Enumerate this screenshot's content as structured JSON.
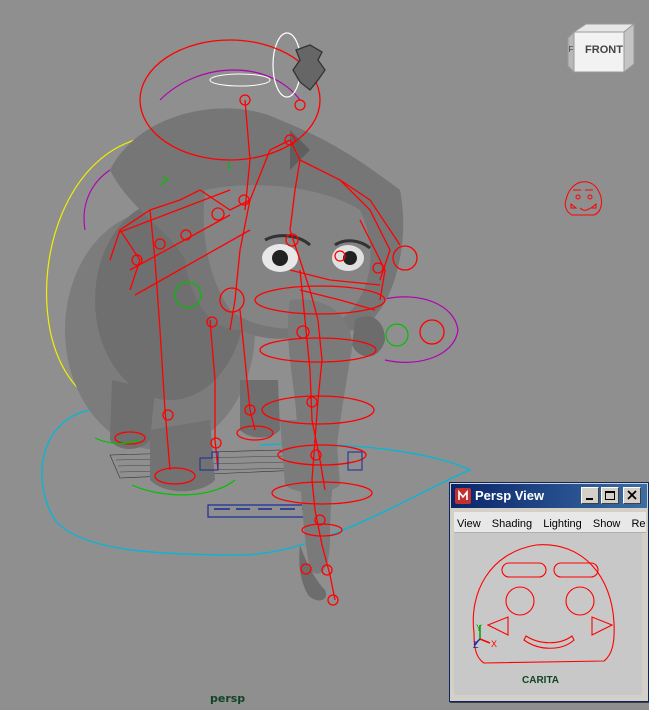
{
  "viewport": {
    "camera_label": "persp",
    "view_cube_face": "FRONT",
    "view_cube_side": "F",
    "background_color": "#8f8f8f",
    "rig_color": "#ff0000"
  },
  "persp_window": {
    "title": "Persp View",
    "menu": [
      "View",
      "Shading",
      "Lighting",
      "Show",
      "Ren"
    ],
    "axis_labels": {
      "y": "Y",
      "z": "Z",
      "x": "X"
    },
    "object_label": "CARITA"
  }
}
